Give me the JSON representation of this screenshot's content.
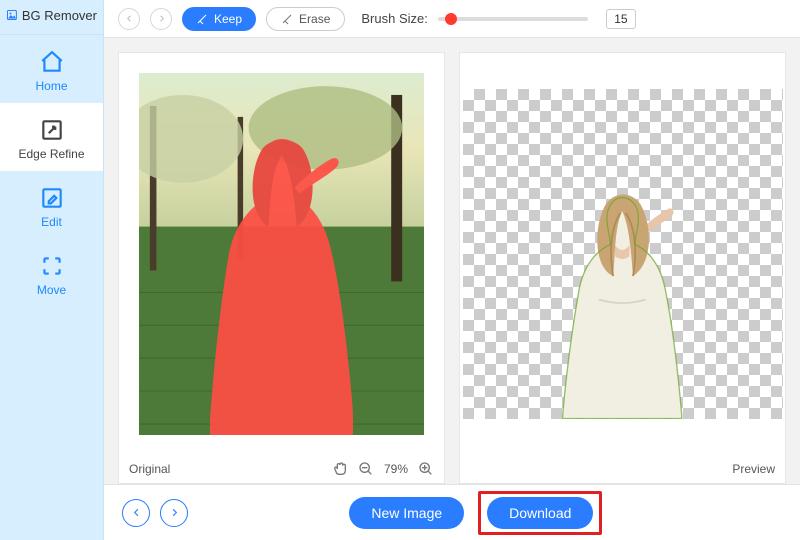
{
  "brand": {
    "name": "BG Remover"
  },
  "sidebar": {
    "items": [
      {
        "label": "Home"
      },
      {
        "label": "Edge Refine"
      },
      {
        "label": "Edit"
      },
      {
        "label": "Move"
      }
    ]
  },
  "toolbar": {
    "keep_label": "Keep",
    "erase_label": "Erase",
    "brush_label": "Brush Size:",
    "brush_value": "15"
  },
  "panels": {
    "original_label": "Original",
    "preview_label": "Preview",
    "zoom": "79%"
  },
  "bottom": {
    "new_image_label": "New Image",
    "download_label": "Download"
  },
  "colors": {
    "accent": "#2a7dff",
    "mask": "#ff4d44",
    "highlight_box": "#e02020"
  }
}
